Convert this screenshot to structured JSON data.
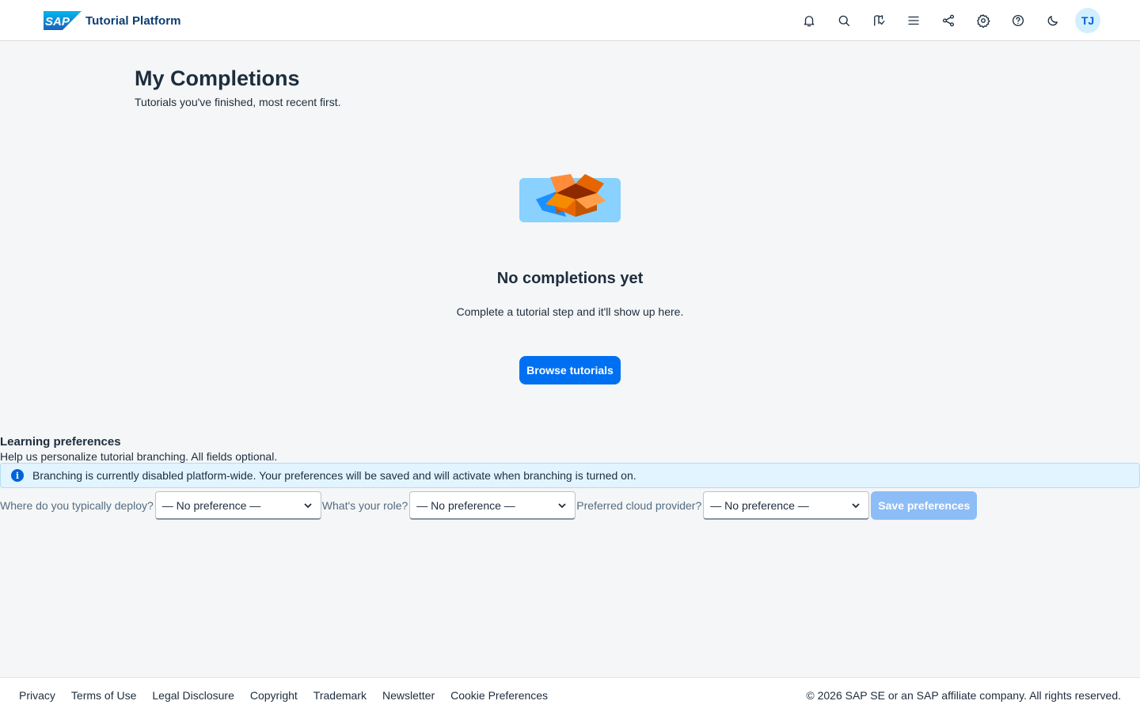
{
  "header": {
    "brand_title": "Tutorial Platform",
    "avatar_initials": "TJ",
    "actions": [
      "bell-icon",
      "search-icon",
      "learning-path-icon",
      "menu-icon",
      "share-icon",
      "settings-icon",
      "help-icon",
      "dark-mode-icon"
    ]
  },
  "page": {
    "title": "My Completions",
    "subtitle": "Tutorials you've finished, most recent first."
  },
  "empty_state": {
    "title": "No completions yet",
    "description": "Complete a tutorial step and it'll show up here.",
    "button_label": "Browse tutorials"
  },
  "preferences": {
    "title": "Learning preferences",
    "subtitle": "Help us personalize tutorial branching. All fields optional.",
    "info_message": "Branching is currently disabled platform-wide. Your preferences will be saved and will activate when branching is turned on.",
    "fields": [
      {
        "label": "Where do you typically deploy?",
        "value": "— No preference —"
      },
      {
        "label": "What's your role?",
        "value": "— No preference —"
      },
      {
        "label": "Preferred cloud provider?",
        "value": "— No preference —"
      }
    ],
    "save_label": "Save preferences"
  },
  "footer": {
    "links": [
      "Privacy",
      "Terms of Use",
      "Legal Disclosure",
      "Copyright",
      "Trademark",
      "Newsletter",
      "Cookie Preferences"
    ],
    "copyright": "© 2026 SAP SE or an SAP affiliate company. All rights reserved."
  },
  "colors": {
    "accent": "#0070f2",
    "brand_text": "#0a3d73",
    "info_background": "#e1f4ff",
    "disabled_button": "#8cbdf7"
  }
}
